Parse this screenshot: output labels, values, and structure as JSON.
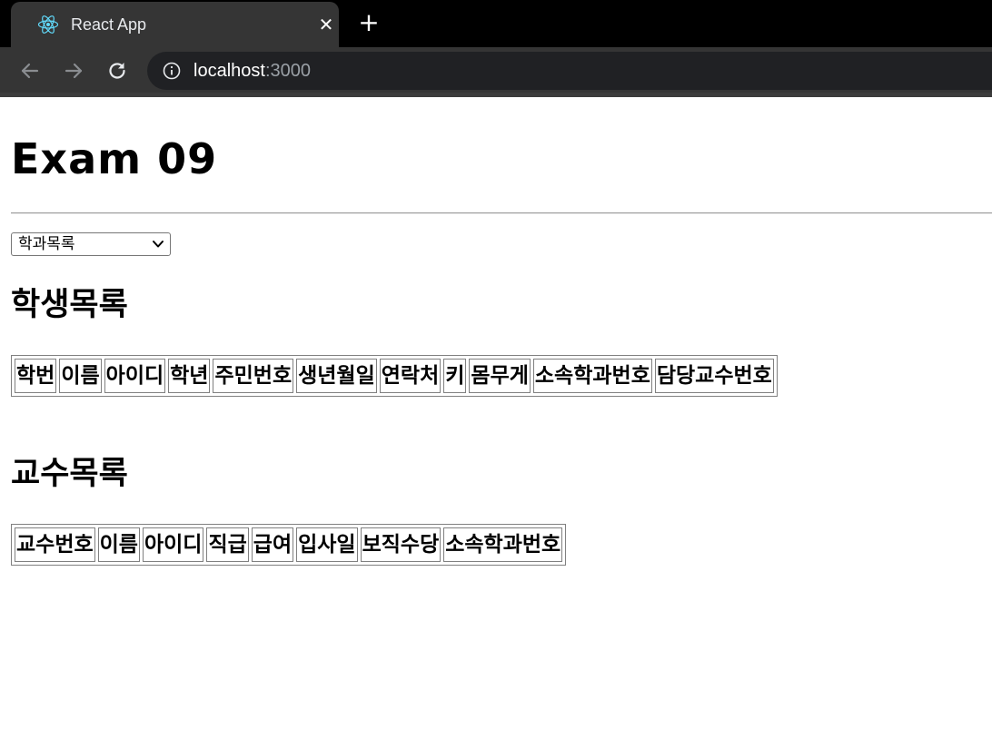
{
  "browser": {
    "tab": {
      "title": "React App",
      "favicon_icon": "react-logo-icon",
      "close_icon": "close-icon"
    },
    "new_tab_icon": "plus-icon",
    "nav": {
      "back_icon": "arrow-left-icon",
      "forward_icon": "arrow-right-icon",
      "reload_icon": "reload-icon"
    },
    "address_bar": {
      "info_icon": "info-icon",
      "host": "localhost",
      "port": ":3000"
    }
  },
  "page": {
    "title": "Exam 09",
    "department_select": {
      "selected_label": "학과목록",
      "chevron_icon": "chevron-down-icon"
    },
    "students": {
      "heading": "학생목록",
      "columns": [
        "학번",
        "이름",
        "아이디",
        "학년",
        "주민번호",
        "생년월일",
        "연락처",
        "키",
        "몸무게",
        "소속학과번호",
        "담당교수번호"
      ]
    },
    "professors": {
      "heading": "교수목록",
      "columns": [
        "교수번호",
        "이름",
        "아이디",
        "직급",
        "급여",
        "입사일",
        "보직수당",
        "소속학과번호"
      ]
    }
  },
  "colors": {
    "tabstrip": "#000000",
    "toolbar": "#353535",
    "omnibox": "#202124",
    "react_logo": "#61dafb"
  }
}
